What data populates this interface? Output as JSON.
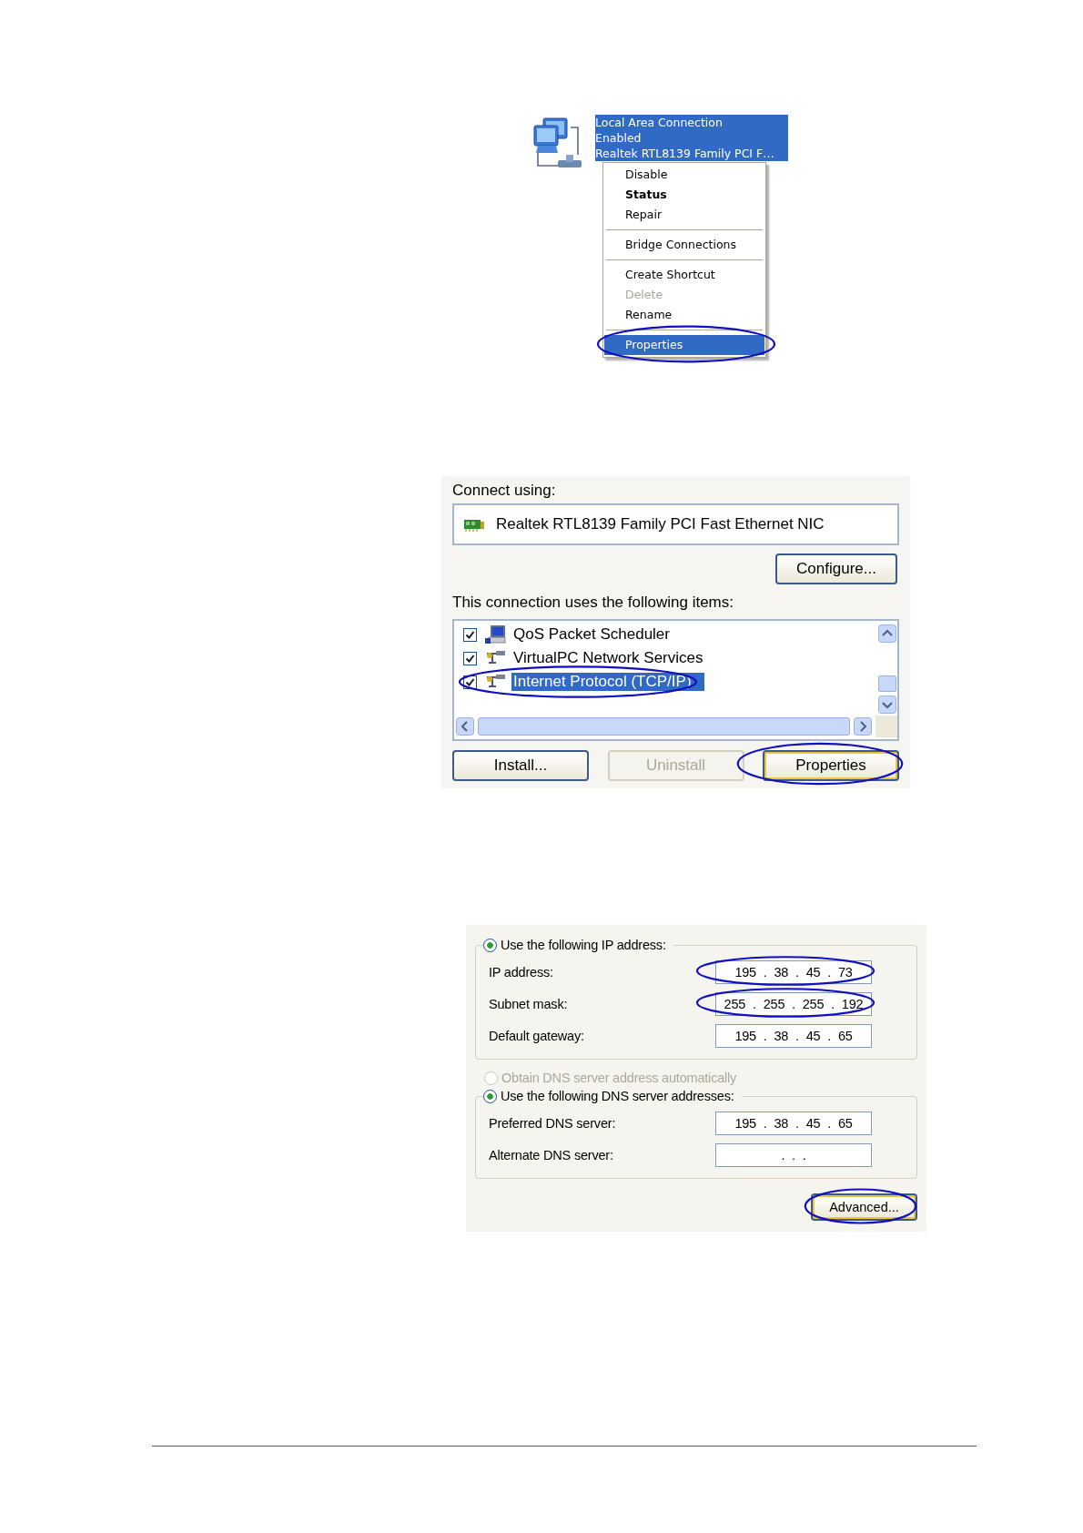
{
  "connection": {
    "lines": [
      "Local Area Connection",
      "Enabled",
      "Realtek RTL8139 Family PCI F…"
    ],
    "selected": true
  },
  "context_menu": {
    "items": [
      {
        "kind": "item",
        "label": "Disable",
        "bold": false,
        "disabled": false,
        "selected": false,
        "circled": false
      },
      {
        "kind": "item",
        "label": "Status",
        "bold": true,
        "disabled": false,
        "selected": false,
        "circled": false
      },
      {
        "kind": "item",
        "label": "Repair",
        "bold": false,
        "disabled": false,
        "selected": false,
        "circled": false
      },
      {
        "kind": "separator"
      },
      {
        "kind": "item",
        "label": "Bridge Connections",
        "bold": false,
        "disabled": false,
        "selected": false,
        "circled": false
      },
      {
        "kind": "separator"
      },
      {
        "kind": "item",
        "label": "Create Shortcut",
        "bold": false,
        "disabled": false,
        "selected": false,
        "circled": false
      },
      {
        "kind": "item",
        "label": "Delete",
        "bold": false,
        "disabled": true,
        "selected": false,
        "circled": false
      },
      {
        "kind": "item",
        "label": "Rename",
        "bold": false,
        "disabled": false,
        "selected": false,
        "circled": false
      },
      {
        "kind": "separator"
      },
      {
        "kind": "item",
        "label": "Properties",
        "bold": false,
        "disabled": false,
        "selected": true,
        "circled": true
      }
    ]
  },
  "connection_properties": {
    "connect_using_label": "Connect using:",
    "adapter": "Realtek RTL8139 Family PCI Fast Ethernet NIC",
    "configure_button": {
      "label": "Configure...",
      "disabled": false,
      "circled": false
    },
    "items_label": "This connection uses the following items:",
    "items": [
      {
        "kind": "scheduler",
        "label": "QoS Packet Scheduler",
        "checked": true,
        "selected": false,
        "circled": false
      },
      {
        "kind": "service",
        "label": "VirtualPC Network Services",
        "checked": true,
        "selected": false,
        "circled": false
      },
      {
        "kind": "service",
        "label": "Internet Protocol (TCP/IP)",
        "checked": true,
        "selected": true,
        "circled": true
      }
    ],
    "buttons": [
      {
        "label": "Install...",
        "disabled": false,
        "circled": false
      },
      {
        "label": "Uninstall",
        "disabled": true,
        "circled": false
      },
      {
        "label": "Properties",
        "disabled": false,
        "circled": true
      }
    ]
  },
  "tcpip_properties": {
    "ip_radio": {
      "label": "Use the following IP address:",
      "selected": true,
      "disabled": false
    },
    "ip_fields": [
      {
        "label": "IP address:",
        "value": "195 . 38 . 45 . 73",
        "circled": true
      },
      {
        "label": "Subnet mask:",
        "value": "255 . 255 . 255 . 192",
        "circled": true
      },
      {
        "label": "Default gateway:",
        "value": "195 . 38 . 45 . 65",
        "circled": false
      }
    ],
    "dns_auto_radio": {
      "label": "Obtain DNS server address automatically",
      "selected": false,
      "disabled": true
    },
    "dns_radio": {
      "label": "Use the following DNS server addresses:",
      "selected": true,
      "disabled": false
    },
    "dns_fields": [
      {
        "label": "Preferred DNS server:",
        "value": "195 . 38 . 45 . 65",
        "circled": false
      },
      {
        "label": "Alternate DNS server:",
        "value": ". . .",
        "circled": false
      }
    ],
    "advanced_button": {
      "label": "Advanced...",
      "disabled": false,
      "circled": true
    }
  }
}
